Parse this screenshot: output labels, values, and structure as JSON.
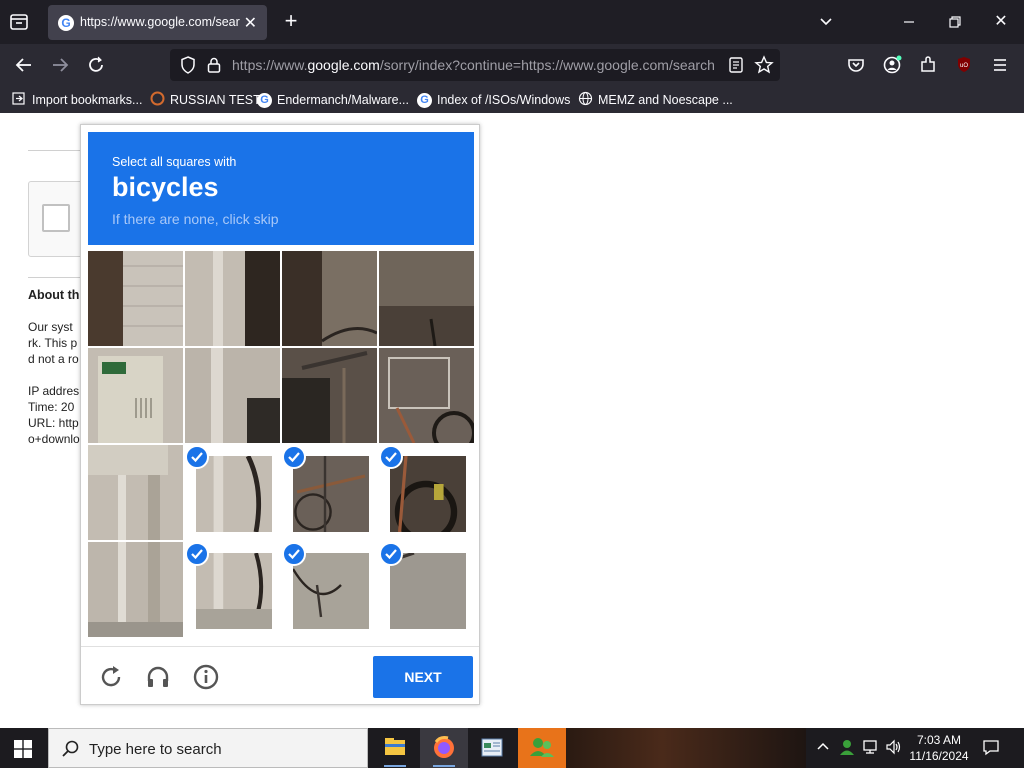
{
  "browser": {
    "tab_title": "https://www.google.com/searc",
    "url_host": "https://www.",
    "url_domain": "google.com",
    "url_rest": "/sorry/index?continue=https://www.google.com/search",
    "bookmarks": [
      {
        "label": "Import bookmarks...",
        "icon": "import-icon"
      },
      {
        "label": "RUSSIAN TEST",
        "icon": "russian-test-favicon"
      },
      {
        "label": "Endermanch/Malware...",
        "icon": "google-favicon"
      },
      {
        "label": "Index of /ISOs/Windows",
        "icon": "google-favicon"
      },
      {
        "label": "MEMZ and Noescape ...",
        "icon": "globe-icon"
      }
    ],
    "favicon_letter": "G"
  },
  "page": {
    "about_heading": "About th",
    "lines": [
      "Our syst",
      "rk. This p",
      "d not a ro",
      "IP addres",
      "Time: 20",
      "URL: http",
      "o+downlo"
    ]
  },
  "captcha": {
    "instruction": "Select all squares with",
    "target": "bicycles",
    "hint": "If there are none, click skip",
    "next_label": "NEXT",
    "selected_cells": [
      [
        2,
        1
      ],
      [
        2,
        2
      ],
      [
        2,
        3
      ],
      [
        3,
        1
      ],
      [
        3,
        2
      ],
      [
        3,
        3
      ]
    ],
    "accent_color": "#1a73e8"
  },
  "taskbar": {
    "search_placeholder": "Type here to search",
    "time": "7:03 AM",
    "date": "11/16/2024"
  }
}
